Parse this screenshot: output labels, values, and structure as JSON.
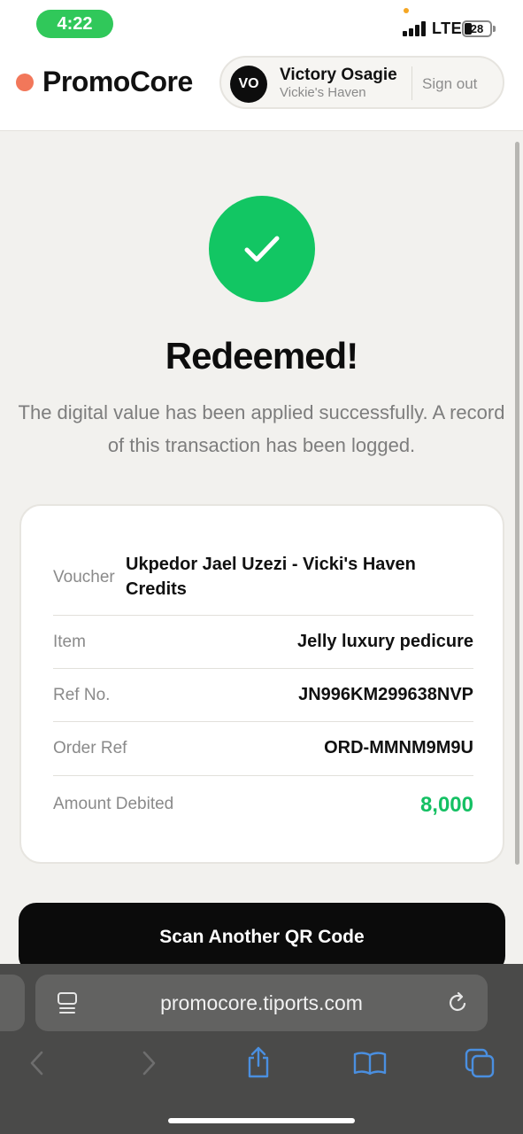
{
  "status_bar": {
    "time": "4:22",
    "network": "LTE",
    "battery": "28",
    "colors": {
      "time_pill": "#30c85a"
    }
  },
  "header": {
    "brand": "PromoCore",
    "brand_dot_color": "#f2775a",
    "user": {
      "initials": "VO",
      "name": "Victory Osagie",
      "store": "Vickie's Haven"
    },
    "sign_out_label": "Sign out"
  },
  "result": {
    "icon": "check-icon",
    "status_color": "#12c663",
    "title": "Redeemed!",
    "message": "The digital value has been applied successfully. A record of this transaction has been logged."
  },
  "details": [
    {
      "label": "Voucher",
      "value": "Ukpedor Jael Uzezi - Vicki's Haven Credits"
    },
    {
      "label": "Item",
      "value": "Jelly luxury pedicure"
    },
    {
      "label": "Ref No.",
      "value": "JN996KM299638NVP"
    },
    {
      "label": "Order Ref",
      "value": "ORD-MMNM9M9U"
    },
    {
      "label": "Amount Debited",
      "value": "8,000"
    }
  ],
  "actions": {
    "scan_label": "Scan Another QR Code"
  },
  "browser": {
    "url": "promocore.tiports.com",
    "icons": [
      "page-menu-icon",
      "reload-icon",
      "back-icon",
      "forward-icon",
      "share-icon",
      "bookmarks-icon",
      "tabs-icon"
    ],
    "accent": "#4a8fe0"
  }
}
